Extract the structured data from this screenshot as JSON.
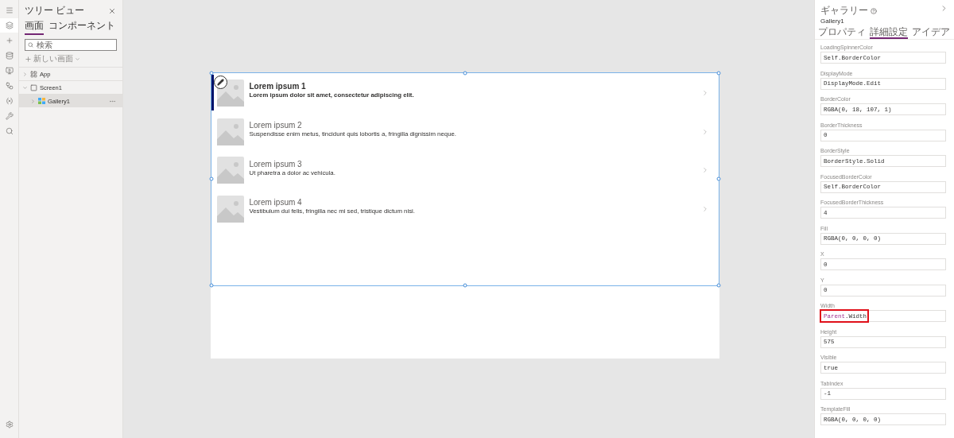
{
  "rail": {
    "items": [
      {
        "kind": "menu",
        "selected": false
      },
      {
        "kind": "layers",
        "selected": true
      },
      {
        "kind": "insert",
        "selected": false
      },
      {
        "kind": "data",
        "selected": false
      },
      {
        "kind": "media",
        "selected": false
      },
      {
        "kind": "flow",
        "selected": false
      },
      {
        "kind": "variables",
        "selected": false
      },
      {
        "kind": "tools",
        "selected": false
      },
      {
        "kind": "search",
        "selected": false
      }
    ],
    "bottom": {
      "kind": "settings"
    }
  },
  "tree": {
    "title": "ツリー ビュー",
    "tabs": [
      {
        "label": "画面",
        "selected": true
      },
      {
        "label": "コンポーネント",
        "selected": false
      }
    ],
    "search": {
      "placeholder": "検索"
    },
    "new_screen": "新しい画面",
    "nodes": [
      {
        "label": "App",
        "kind": "app",
        "expanded": false,
        "selected": false
      },
      {
        "label": "Screen1",
        "kind": "screen",
        "expanded": true,
        "selected": false,
        "children": [
          {
            "label": "Gallery1",
            "kind": "gallery",
            "expanded": false,
            "selected": true
          }
        ]
      }
    ]
  },
  "gallery": {
    "items": [
      {
        "title": "Lorem ipsum 1",
        "subtitle": "Lorem ipsum dolor sit amet, consectetur adipiscing elit.",
        "selected": true
      },
      {
        "title": "Lorem ipsum 2",
        "subtitle": "Suspendisse enim metus, tincidunt quis lobortis a, fringilla dignissim neque.",
        "selected": false
      },
      {
        "title": "Lorem ipsum 3",
        "subtitle": "Ut pharetra a dolor ac vehicula.",
        "selected": false
      },
      {
        "title": "Lorem ipsum 4",
        "subtitle": "Vestibulum dui felis, fringilla nec mi sed, tristique dictum nisi.",
        "selected": false
      }
    ]
  },
  "properties": {
    "type_label": "ギャラリー",
    "name": "Gallery1",
    "tabs": [
      {
        "label": "プロパティ",
        "selected": false
      },
      {
        "label": "詳細設定",
        "selected": true
      },
      {
        "label": "アイデア",
        "selected": false
      }
    ],
    "fields": [
      {
        "label": "LoadingSpinnerColor",
        "parts": [
          {
            "text": "Self.BorderColor",
            "kind": "plain"
          }
        ],
        "highlighted": false
      },
      {
        "label": "DisplayMode",
        "parts": [
          {
            "text": "DisplayMode.Edit",
            "kind": "plain"
          }
        ],
        "highlighted": false
      },
      {
        "label": "BorderColor",
        "parts": [
          {
            "text": "RGBA(0, 18, 107, 1)",
            "kind": "plain"
          }
        ],
        "highlighted": false
      },
      {
        "label": "BorderThickness",
        "parts": [
          {
            "text": "0",
            "kind": "plain"
          }
        ],
        "highlighted": false
      },
      {
        "label": "BorderStyle",
        "parts": [
          {
            "text": "BorderStyle.Solid",
            "kind": "plain"
          }
        ],
        "highlighted": false
      },
      {
        "label": "FocusedBorderColor",
        "parts": [
          {
            "text": "Self.BorderColor",
            "kind": "plain"
          }
        ],
        "highlighted": false
      },
      {
        "label": "FocusedBorderThickness",
        "parts": [
          {
            "text": "4",
            "kind": "plain"
          }
        ],
        "highlighted": false
      },
      {
        "label": "Fill",
        "parts": [
          {
            "text": "RGBA(0, 0, 0, 0)",
            "kind": "plain"
          }
        ],
        "highlighted": false
      },
      {
        "label": "X",
        "parts": [
          {
            "text": "0",
            "kind": "plain"
          }
        ],
        "highlighted": false
      },
      {
        "label": "Y",
        "parts": [
          {
            "text": "0",
            "kind": "plain"
          }
        ],
        "highlighted": false
      },
      {
        "label": "Width",
        "parts": [
          {
            "text": "Parent",
            "kind": "keyword"
          },
          {
            "text": ".Width",
            "kind": "plain"
          }
        ],
        "highlighted": true
      },
      {
        "label": "Height",
        "parts": [
          {
            "text": "575",
            "kind": "plain"
          }
        ],
        "highlighted": false
      },
      {
        "label": "Visible",
        "parts": [
          {
            "text": "true",
            "kind": "plain"
          }
        ],
        "highlighted": false
      },
      {
        "label": "TabIndex",
        "parts": [
          {
            "text": "-1",
            "kind": "plain"
          }
        ],
        "highlighted": false
      },
      {
        "label": "TemplateFill",
        "parts": [
          {
            "text": "RGBA(0, 0, 0, 0)",
            "kind": "plain"
          }
        ],
        "highlighted": false
      }
    ]
  }
}
